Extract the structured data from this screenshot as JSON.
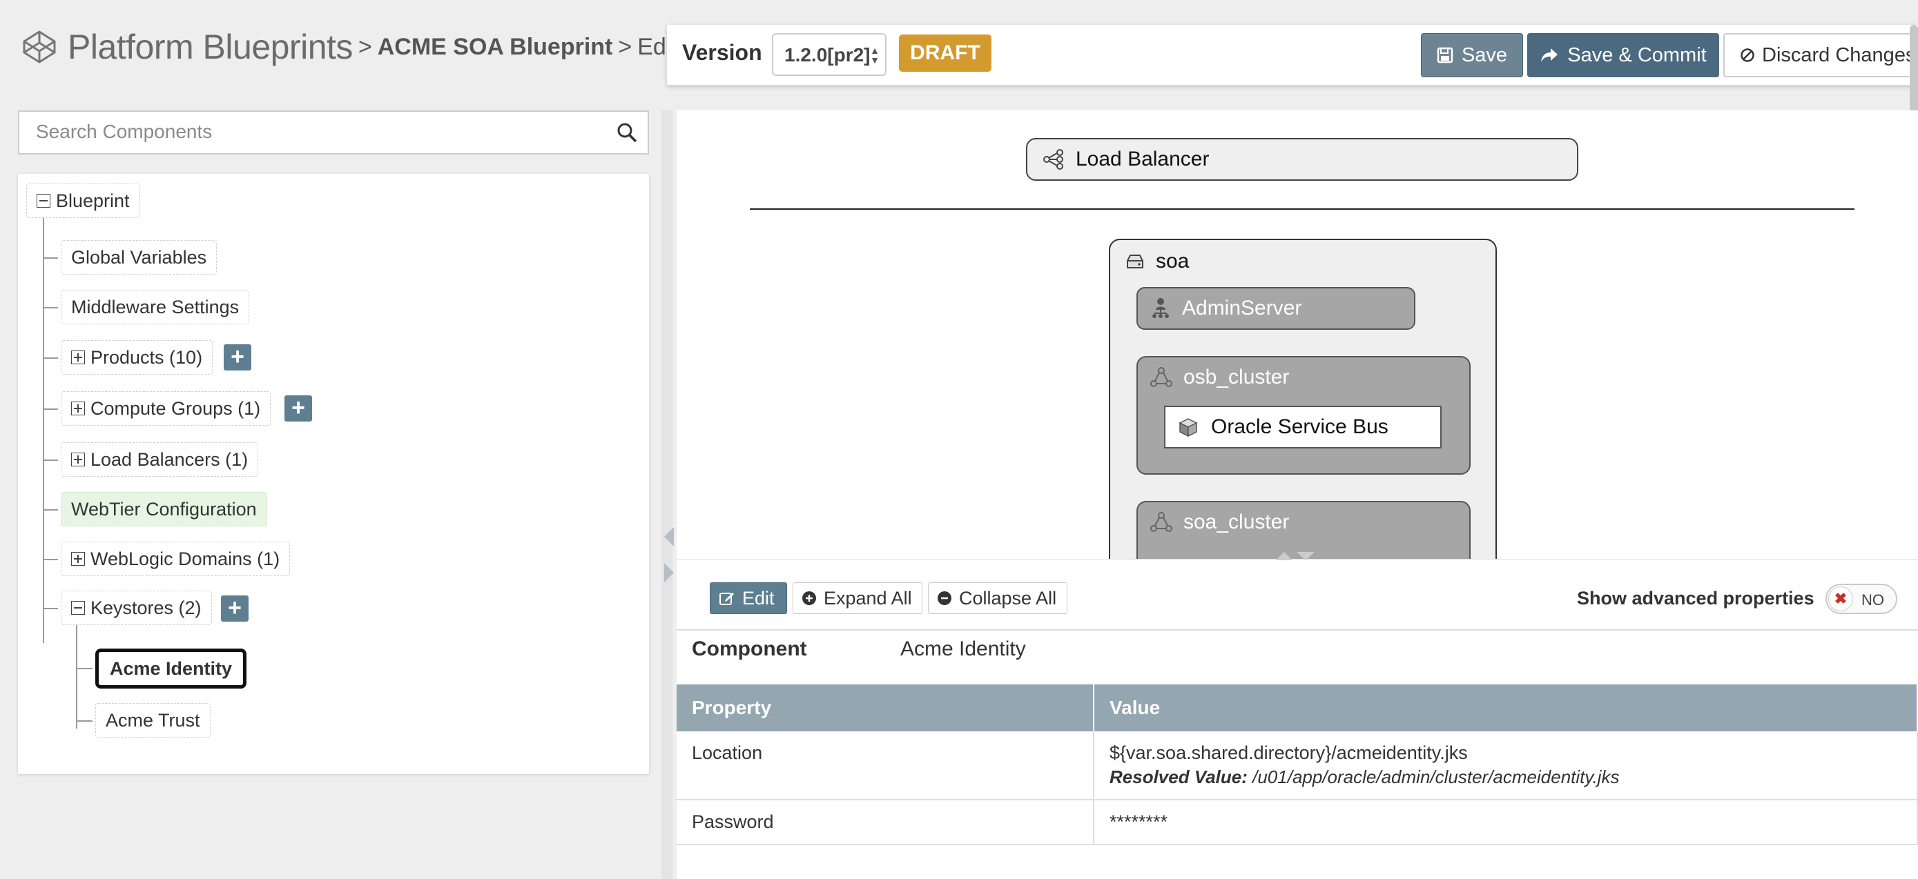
{
  "header": {
    "app_title": "Platform Blueprints",
    "crumb_sep1": ">",
    "crumb_blueprint": "ACME SOA Blueprint",
    "crumb_sep2": ">",
    "crumb_mode": "Edit"
  },
  "toolbar": {
    "version_label": "Version",
    "version_value": "1.2.0[pr2]",
    "status_badge": "DRAFT",
    "save_label": "Save",
    "save_commit_label": "Save & Commit",
    "discard_label": "Discard Changes"
  },
  "search": {
    "placeholder": "Search Components"
  },
  "tree": {
    "root": "Blueprint",
    "items": [
      {
        "label": "Global Variables"
      },
      {
        "label": "Middleware Settings"
      },
      {
        "label": "Products (10)"
      },
      {
        "label": "Compute Groups (1)"
      },
      {
        "label": "Load Balancers (1)"
      },
      {
        "label": "WebTier Configuration"
      },
      {
        "label": "WebLogic Domains (1)"
      },
      {
        "label": "Keystores (2)"
      }
    ],
    "keystores": [
      {
        "label": "Acme Identity",
        "selected": true
      },
      {
        "label": "Acme Trust"
      }
    ],
    "add_glyph": "+"
  },
  "canvas": {
    "load_balancer": "Load Balancer",
    "domain": "soa",
    "admin_server": "AdminServer",
    "cluster1": "osb_cluster",
    "cluster1_product": "Oracle Service Bus",
    "cluster2": "soa_cluster"
  },
  "properties": {
    "edit_label": "Edit",
    "expand_label": "Expand All",
    "collapse_label": "Collapse All",
    "advanced_label": "Show advanced properties",
    "toggle_state": "NO",
    "component_label": "Component",
    "component_value": "Acme Identity",
    "columns": [
      "Property",
      "Value"
    ],
    "rows": [
      {
        "property": "Location",
        "value": "${var.soa.shared.directory}/acmeidentity.jks",
        "resolved_label": "Resolved Value:",
        "resolved_value": "/u01/app/oracle/admin/cluster/acmeidentity.jks"
      },
      {
        "property": "Password",
        "value": "********"
      }
    ]
  },
  "colors": {
    "accent": "#5e7f91",
    "draft": "#d39a2e",
    "webtier": "#e6f6e3",
    "table_header": "#94a6b0"
  }
}
